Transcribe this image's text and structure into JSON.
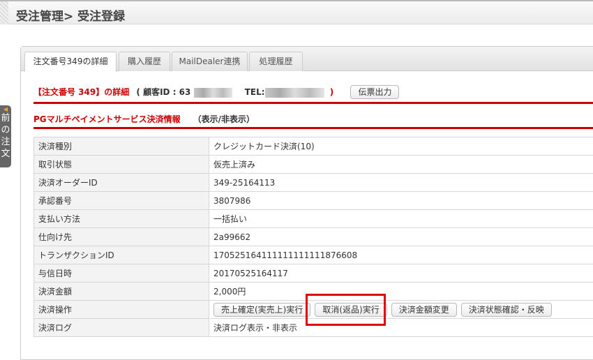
{
  "header": {
    "title": "受注管理> 受注登録"
  },
  "sidetab": {
    "label": [
      "前",
      "の",
      "注",
      "文"
    ]
  },
  "tabs": [
    "注文番号349の詳細",
    "購入履歴",
    "MailDealer連携",
    "処理履歴"
  ],
  "order": {
    "title": "【注文番号 349】の詳細",
    "customer_prefix": "( 顧客ID : 63",
    "tel_label": "TEL:",
    "close": ")",
    "print_button": "伝票出力"
  },
  "section": {
    "title": "PGマルチペイメントサービス決済情報",
    "toggle": "（表示/非表示）"
  },
  "rows": [
    {
      "label": "決済種別",
      "value": "クレジットカード決済(10)"
    },
    {
      "label": "取引状態",
      "value": "仮売上済み"
    },
    {
      "label": "決済オーダーID",
      "value": "349-25164113"
    },
    {
      "label": "承認番号",
      "value": "3807986"
    },
    {
      "label": "支払い方法",
      "value": "一括払い"
    },
    {
      "label": "仕向け先",
      "value": "2a99662"
    },
    {
      "label": "トランザクションID",
      "value": "170525164111111111111876608"
    },
    {
      "label": "与信日時",
      "value": "20170525164117"
    },
    {
      "label": "決済金額",
      "value": "2,000円"
    },
    {
      "label": "決済操作",
      "buttons": [
        "売上確定(実売上)実行",
        "取消(返品)実行",
        "決済金額変更",
        "決済状態確認・反映"
      ]
    },
    {
      "label": "決済ログ",
      "value": "決済ログ表示・非表示"
    }
  ]
}
